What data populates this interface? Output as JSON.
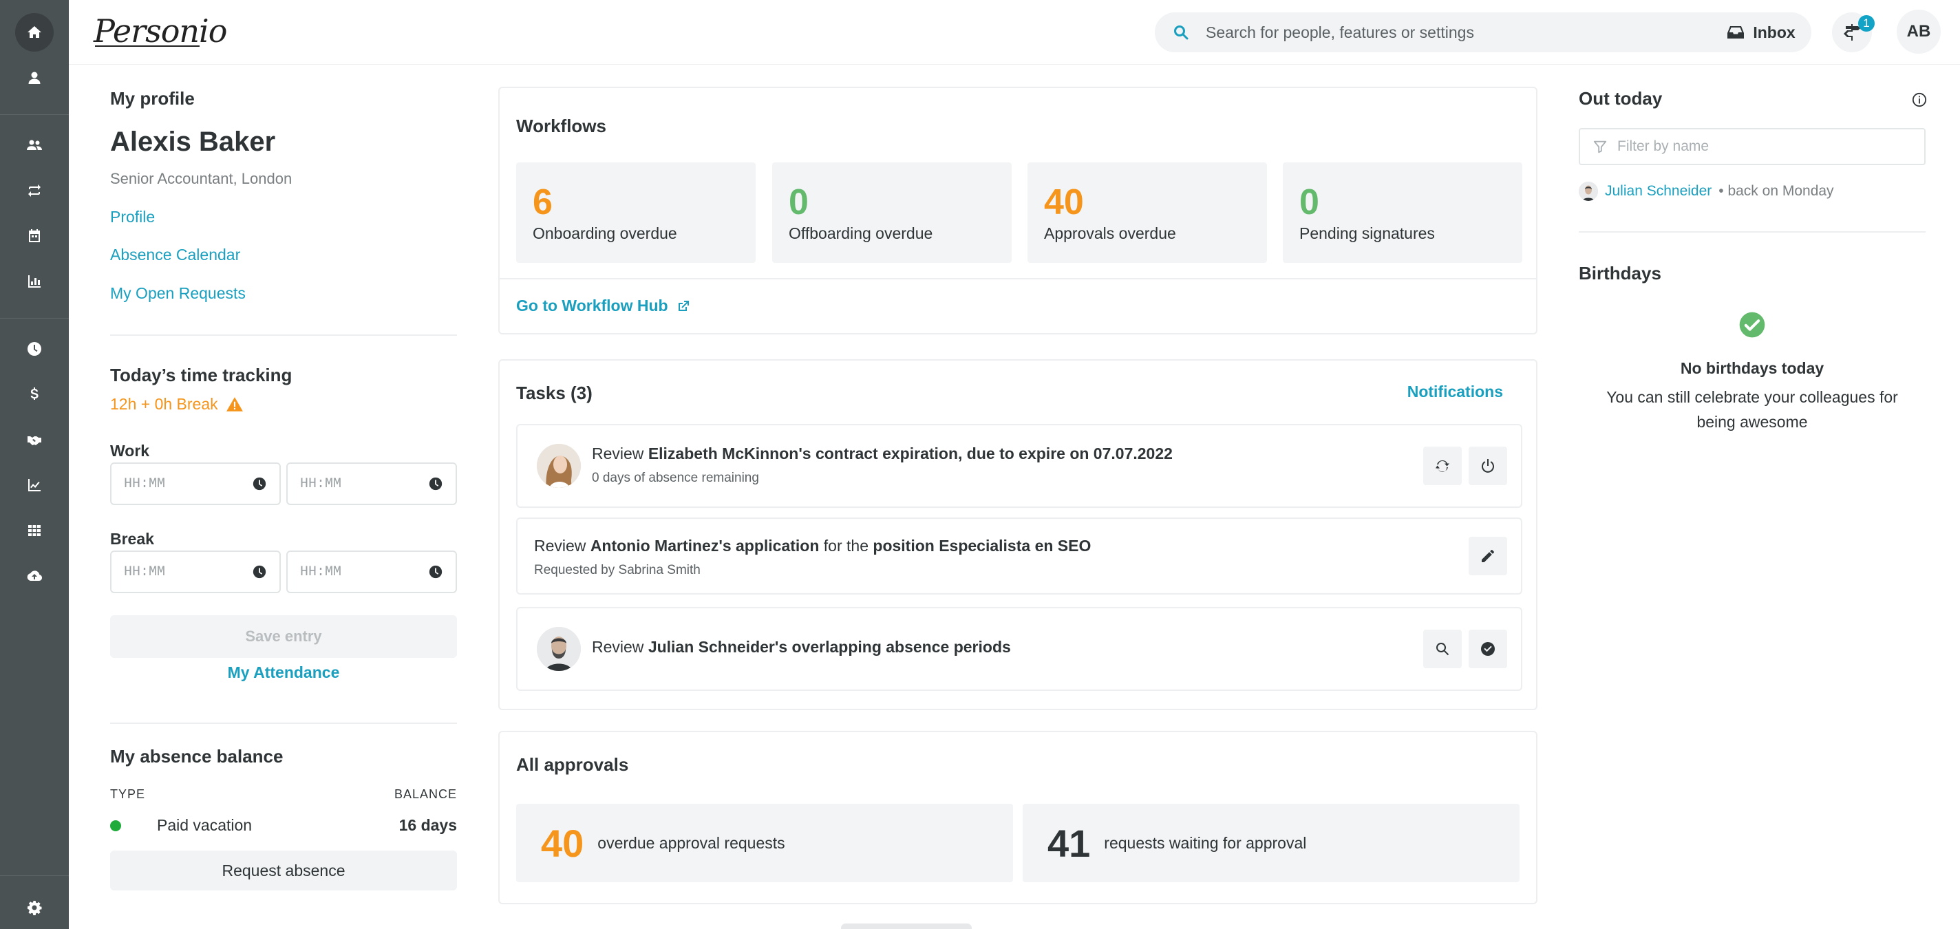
{
  "app": {
    "logo_text": "Personio"
  },
  "sidebar": {
    "items": [
      {
        "icon": "home-icon",
        "active": true
      },
      {
        "icon": "person-icon"
      },
      {
        "icon": "people-icon"
      },
      {
        "icon": "repeat-icon"
      },
      {
        "icon": "calendar-icon"
      },
      {
        "icon": "bar-chart-icon"
      },
      {
        "icon": "clock-icon"
      },
      {
        "icon": "dollar-icon"
      },
      {
        "icon": "handshake-icon"
      },
      {
        "icon": "line-chart-icon"
      },
      {
        "icon": "apps-grid-icon"
      },
      {
        "icon": "cloud-upload-icon"
      },
      {
        "icon": "settings-gear-icon"
      }
    ]
  },
  "header": {
    "search_placeholder": "Search for people, features or settings",
    "inbox_label": "Inbox",
    "notification_count": "1",
    "user_initials": "AB"
  },
  "profile": {
    "section_title": "My profile",
    "name": "Alexis Baker",
    "role": "Senior Accountant, London",
    "links": [
      "Profile",
      "Absence Calendar",
      "My Open Requests"
    ]
  },
  "time_tracking": {
    "title": "Today’s time tracking",
    "summary": "12h + 0h Break",
    "work_label": "Work",
    "break_label": "Break",
    "time_placeholder": "HH:MM",
    "save_label": "Save entry",
    "attendance_link": "My Attendance"
  },
  "absence": {
    "title": "My absence balance",
    "col_type": "TYPE",
    "col_balance": "BALANCE",
    "rows": [
      {
        "type": "Paid vacation",
        "balance": "16 days",
        "color": "#1fab3a"
      }
    ],
    "request_label": "Request absence"
  },
  "workflows": {
    "title": "Workflows",
    "stats": [
      {
        "value": "6",
        "label": "Onboarding overdue",
        "color": "orange"
      },
      {
        "value": "0",
        "label": "Offboarding overdue",
        "color": "green"
      },
      {
        "value": "40",
        "label": "Approvals overdue",
        "color": "orange"
      },
      {
        "value": "0",
        "label": "Pending signatures",
        "color": "green"
      }
    ],
    "hub_link": "Go to Workflow Hub"
  },
  "tasks": {
    "title": "Tasks (3)",
    "notifications_link": "Notifications",
    "items": [
      {
        "pre": "Review ",
        "bold1": "Elizabeth McKinnon's contract expiration, due to expire on 07.07.2022",
        "mid": "",
        "bold2": "",
        "sub": "0 days of absence remaining",
        "actions": [
          "refresh-icon",
          "power-icon"
        ]
      },
      {
        "pre": "Review ",
        "bold1": "Antonio Martinez's application",
        "mid": " for the ",
        "bold2": "position Especialista en SEO",
        "sub": "Requested by Sabrina Smith",
        "actions": [
          "edit-pencil-icon"
        ]
      },
      {
        "pre": "Review ",
        "bold1": "Julian Schneider's overlapping absence periods",
        "mid": "",
        "bold2": "",
        "sub": "",
        "actions": [
          "search-icon",
          "check-circle-icon"
        ]
      }
    ]
  },
  "approvals": {
    "title": "All approvals",
    "overdue_value": "40",
    "overdue_label": "overdue approval requests",
    "waiting_value": "41",
    "waiting_label": "requests waiting for approval"
  },
  "out_today": {
    "title": "Out today",
    "filter_placeholder": "Filter by name",
    "people": [
      {
        "name": "Julian Schneider",
        "note": "• back on Monday"
      }
    ]
  },
  "birthdays": {
    "title": "Birthdays",
    "empty_title": "No birthdays today",
    "empty_text": "You can still celebrate your colleagues for being awesome"
  },
  "colors": {
    "accent": "#1a9fbf",
    "warning": "#f5951c",
    "success": "#63b96c",
    "sidebar": "#4b5254"
  }
}
